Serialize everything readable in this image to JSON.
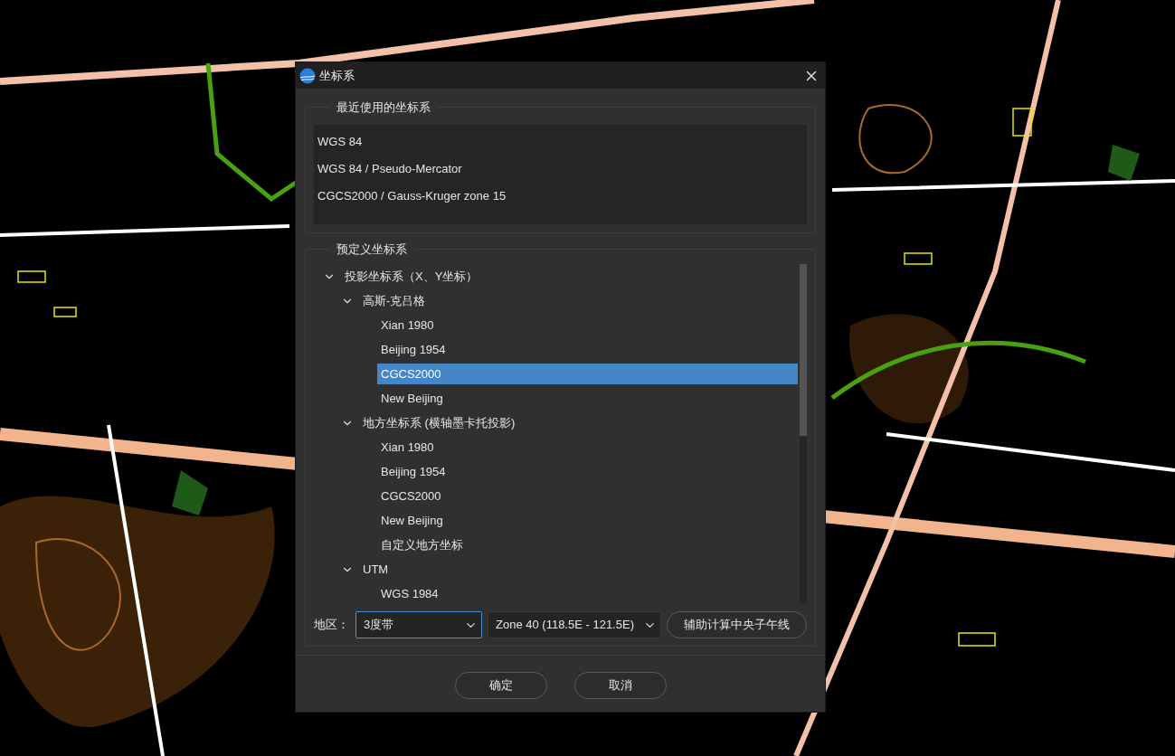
{
  "window": {
    "title": "坐标系"
  },
  "recent": {
    "title": "最近使用的坐标系",
    "items": [
      {
        "label": "WGS 84"
      },
      {
        "label": "WGS 84 / Pseudo-Mercator"
      },
      {
        "label": "CGCS2000 / Gauss-Kruger zone 15"
      }
    ]
  },
  "predefined": {
    "title": "预定义坐标系",
    "tree": [
      {
        "label": "投影坐标系（X、Y坐标）",
        "expanded": true,
        "selected": false,
        "children": [
          {
            "label": "高斯-克吕格",
            "expanded": true,
            "selected": false,
            "children": [
              {
                "label": "Xian 1980",
                "selected": false
              },
              {
                "label": "Beijing 1954",
                "selected": false
              },
              {
                "label": "CGCS2000",
                "selected": true
              },
              {
                "label": "New Beijing",
                "selected": false
              }
            ]
          },
          {
            "label": "地方坐标系 (横轴墨卡托投影)",
            "expanded": true,
            "selected": false,
            "children": [
              {
                "label": "Xian 1980",
                "selected": false
              },
              {
                "label": "Beijing 1954",
                "selected": false
              },
              {
                "label": "CGCS2000",
                "selected": false
              },
              {
                "label": "New Beijing",
                "selected": false
              },
              {
                "label": "自定义地方坐标",
                "selected": false
              }
            ]
          },
          {
            "label": "UTM",
            "expanded": true,
            "selected": false,
            "children": [
              {
                "label": "WGS 1984",
                "selected": false
              }
            ]
          }
        ]
      }
    ],
    "region_label": "地区：",
    "region_select": {
      "value": "3度带",
      "focused": true
    },
    "zone_select": {
      "value": "Zone 40 (118.5E - 121.5E)",
      "focused": false
    },
    "meridian_button": "辅助计算中央子午线"
  },
  "buttons": [
    "确定",
    "取消"
  ]
}
